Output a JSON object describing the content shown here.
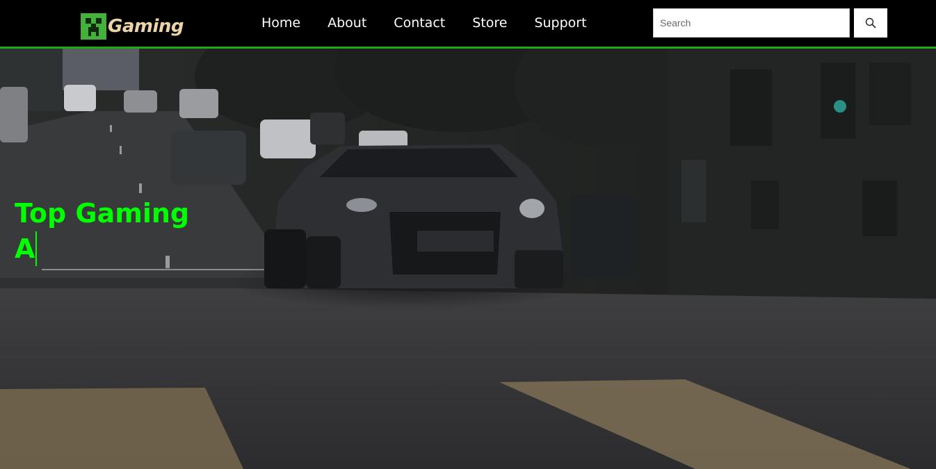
{
  "header": {
    "logo_text": "Gaming",
    "logo_icon": "creeper-face-icon",
    "accent_color": "#1faa12",
    "nav": [
      {
        "label": "Home"
      },
      {
        "label": "About"
      },
      {
        "label": "Contact"
      },
      {
        "label": "Store"
      },
      {
        "label": "Support"
      }
    ],
    "search": {
      "placeholder": "Search",
      "value": "",
      "button_icon": "magnifier-icon"
    }
  },
  "hero": {
    "line1": "Top Gaming",
    "line2": "A",
    "text_color": "#00ff00",
    "background": "dark street scene with sports car (video frame)"
  }
}
